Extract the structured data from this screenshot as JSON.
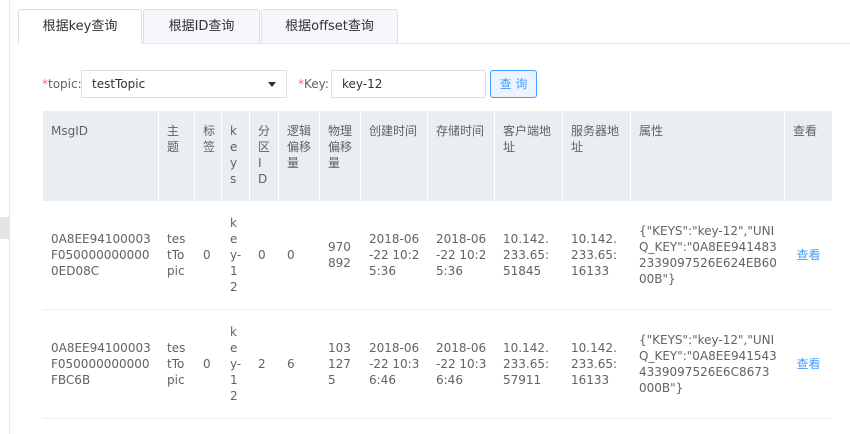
{
  "tabs": [
    {
      "label": "根据key查询"
    },
    {
      "label": "根据ID查询"
    },
    {
      "label": "根据offset查询"
    }
  ],
  "search": {
    "required_mark": "*",
    "topic_label": "topic:",
    "topic_value": "testTopic",
    "key_label": "Key:",
    "key_value": "key-12",
    "button_label": "查 询"
  },
  "table": {
    "headers": [
      "MsgID",
      "主题",
      "标签",
      "keys",
      "分区ID",
      "逻辑偏移量",
      "物理偏移量",
      "创建时间",
      "存储时间",
      "客户端地址",
      "服务器地址",
      "属性",
      "查看"
    ],
    "rows": [
      {
        "msgid": "0A8EE94100003F0500000000000ED08C",
        "topic": "testTopic",
        "tag": "0",
        "keys": "key-12",
        "partition": "0",
        "logic_offset": "0",
        "physical_offset": "970892",
        "created": "2018-06-22 10:25:36",
        "stored": "2018-06-22 10:25:36",
        "client": "10.142.233.65:51845",
        "server": "10.142.233.65:16133",
        "props": "{\"KEYS\":\"key-12\",\"UNIQ_KEY\":\"0A8EE9414832339097526E624EB6000B\"}",
        "view": "查看"
      },
      {
        "msgid": "0A8EE94100003F050000000000FBC6B",
        "topic": "testTopic",
        "tag": "0",
        "keys": "key-12",
        "partition": "2",
        "logic_offset": "6",
        "physical_offset": "1031275",
        "created": "2018-06-22 10:36:46",
        "stored": "2018-06-22 10:36:46",
        "client": "10.142.233.65:57911",
        "server": "10.142.233.65:16133",
        "props": "{\"KEYS\":\"key-12\",\"UNIQ_KEY\":\"0A8EE9415434339097526E6C8673000B\"}",
        "view": "查看"
      }
    ]
  }
}
